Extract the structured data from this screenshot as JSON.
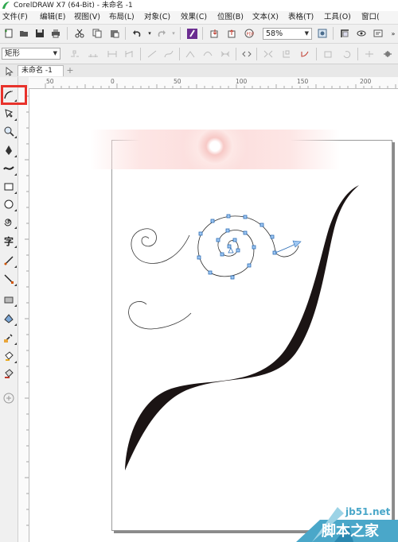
{
  "window": {
    "title": "CorelDRAW X7 (64-Bit) - 未命名 -1",
    "accent": "#e8322b"
  },
  "menu": [
    {
      "label": "文件(F)"
    },
    {
      "label": "编辑(E)"
    },
    {
      "label": "视图(V)"
    },
    {
      "label": "布局(L)"
    },
    {
      "label": "对象(C)"
    },
    {
      "label": "效果(C)"
    },
    {
      "label": "位图(B)"
    },
    {
      "label": "文本(X)"
    },
    {
      "label": "表格(T)"
    },
    {
      "label": "工具(O)"
    },
    {
      "label": "窗口("
    }
  ],
  "toolbar": {
    "zoom_value": "58%",
    "icons": [
      "new-icon",
      "open-icon",
      "save-icon",
      "print-icon",
      "cut-icon",
      "copy-icon",
      "paste-icon",
      "undo-icon",
      "redo-icon",
      "search-content-icon",
      "import-icon",
      "export-icon",
      "publish-pdf-icon",
      "zoom-fit-icon",
      "snap-icon",
      "view-icon",
      "options-icon"
    ]
  },
  "property_bar": {
    "object_type": "矩形",
    "icons": [
      "break-path-icon",
      "join-nodes-icon",
      "node-a-icon",
      "node-b-icon",
      "curve-icon",
      "line-icon",
      "cusp-icon",
      "smooth-icon",
      "symmetric-icon",
      "reverse-icon",
      "extend-icon",
      "extract-icon",
      "reduce-icon",
      "align-icon"
    ]
  },
  "tabs": [
    {
      "label": "未命名 -1"
    }
  ],
  "rulers": {
    "horizontal": [
      "50",
      "0",
      "50",
      "100",
      "150",
      "200"
    ],
    "vertical_unit": ""
  },
  "toolbox": [
    "pick-tool-icon",
    "freehand-tool-icon",
    "shape-tool-icon",
    "zoom-tool-icon",
    "pen-tool-icon",
    "artistic-media-icon",
    "rectangle-tool-icon",
    "ellipse-tool-icon",
    "spiral-tool-icon",
    "text-tool-icon",
    "dimension-tool-icon",
    "connector-tool-icon",
    "drop-shadow-icon",
    "transparency-icon",
    "eyedropper-icon",
    "fill-tool-icon",
    "smart-fill-icon",
    "add-tool-icon"
  ],
  "watermark": {
    "url": "jb51.net",
    "name": "脚本之家"
  }
}
